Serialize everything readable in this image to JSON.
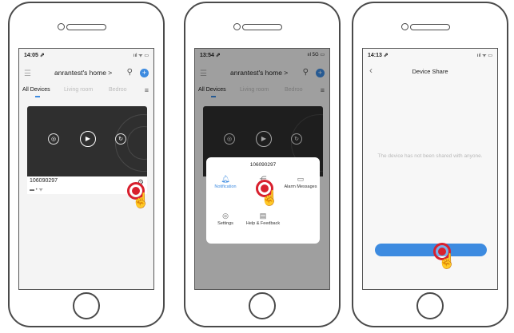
{
  "colors": {
    "accent": "#3d8be0",
    "tap": "#d8202e"
  },
  "phone1": {
    "time": "14:05 ⇗",
    "signal": "ııl ᯤ ▭",
    "home_title": "anrantest's home >",
    "tabs": [
      "All Devices",
      "Living room",
      "Bedroo"
    ],
    "device_name": "106090297",
    "icons": {
      "menu": "menu-icon",
      "user": "user-icon",
      "add": "plus-icon",
      "gear": "gear-icon"
    }
  },
  "phone2": {
    "time": "13:54 ⇗",
    "signal": "ııl 5G ▭",
    "home_title": "anrantest's home >",
    "tabs": [
      "All Devices",
      "Living room",
      "Bedroo"
    ],
    "popup": {
      "device_name": "106090297",
      "items": [
        {
          "label": "Notification",
          "icon": "bell-icon"
        },
        {
          "label": "Share",
          "icon": "share-icon"
        },
        {
          "label": "Alarm Messages",
          "icon": "alarm-message-icon"
        },
        {
          "label": "Settings",
          "icon": "settings-icon"
        },
        {
          "label": "Help & Feedback",
          "icon": "help-icon"
        }
      ]
    }
  },
  "phone3": {
    "time": "14:13 ⇗",
    "signal": "ııl ᯤ ▭",
    "title": "Device Share",
    "message": "The device has not been shared with anyone."
  }
}
